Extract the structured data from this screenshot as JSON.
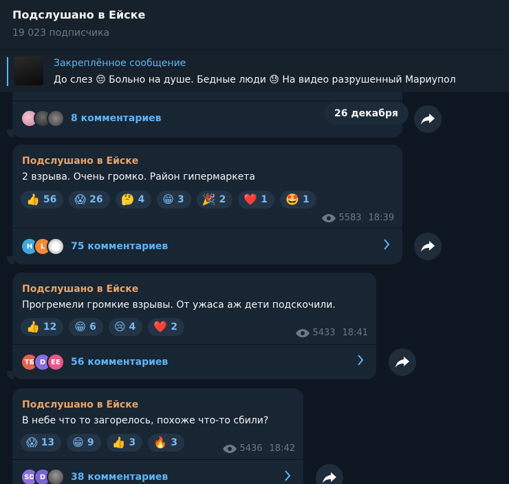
{
  "header": {
    "title": "Подслушано в Ейске",
    "subscribers": "19 023 подписчика"
  },
  "pinned": {
    "title": "Закреплённое сообщение",
    "text": "До слез 😔 Больно на душе. Бедные люди 😓 На видео разрушенный Мариупол"
  },
  "date_chip": "26 декабря",
  "posts": [
    {
      "comments_label": "8 комментариев"
    },
    {
      "author": "Подслушано в Ейске",
      "text": "2 взрыва. Очень громко. Район гипермаркета",
      "reactions": [
        {
          "emoji": "👍",
          "count": "56"
        },
        {
          "emoji": "😱",
          "count": "26"
        },
        {
          "emoji": "🤔",
          "count": "4"
        },
        {
          "emoji": "😁",
          "count": "3"
        },
        {
          "emoji": "🎉",
          "count": "2"
        },
        {
          "emoji": "❤️",
          "count": "1"
        },
        {
          "emoji": "🤩",
          "count": "1"
        }
      ],
      "views": "5583",
      "time": "18:39",
      "avatars": [
        "H",
        "L",
        ""
      ],
      "comments_label": "75 комментариев"
    },
    {
      "author": "Подслушано в Ейске",
      "text": "Прогремели громкие взрывы. От ужаса аж дети подскочили.",
      "reactions": [
        {
          "emoji": "👍",
          "count": "12"
        },
        {
          "emoji": "😁",
          "count": "6"
        },
        {
          "emoji": "😢",
          "count": "4"
        },
        {
          "emoji": "❤️",
          "count": "2"
        }
      ],
      "views": "5433",
      "time": "18:41",
      "avatars": [
        "ТБ",
        "D",
        "EE"
      ],
      "comments_label": "56 комментариев"
    },
    {
      "author": "Подслушано в Ейске",
      "text": "В небе что то загорелось, похоже что-то сбили?",
      "reactions": [
        {
          "emoji": "😱",
          "count": "13"
        },
        {
          "emoji": "😁",
          "count": "9"
        },
        {
          "emoji": "👍",
          "count": "3"
        },
        {
          "emoji": "🔥",
          "count": "3"
        }
      ],
      "views": "5436",
      "time": "18:42",
      "avatars": [
        "SD",
        "D",
        ""
      ],
      "comments_label": "38 комментариев"
    }
  ],
  "colors": {
    "background": "#0e1621",
    "bubble": "#182533",
    "author": "#e9a469",
    "link": "#5eb5f7",
    "reaction_bg": "#233447",
    "muted": "#6d7883"
  },
  "icons": {
    "share": "share-arrow-icon",
    "views": "eye-icon",
    "chevron": "chevron-right-icon"
  }
}
